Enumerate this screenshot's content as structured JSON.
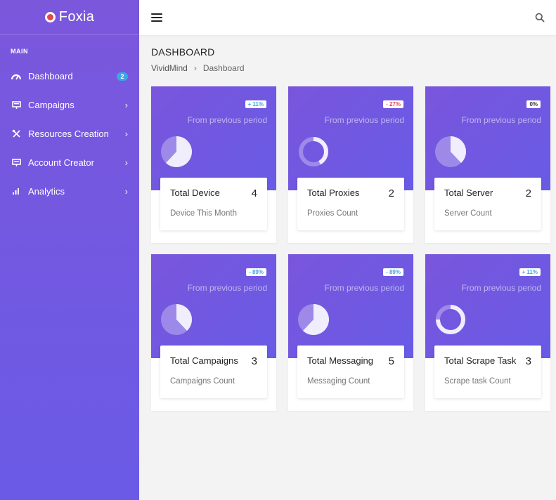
{
  "brand": {
    "name": "Foxia"
  },
  "sidebar": {
    "section_title": "MAIN",
    "items": [
      {
        "label": "Dashboard",
        "icon": "gauge-icon",
        "badge": "2"
      },
      {
        "label": "Campaigns",
        "icon": "monitor-icon"
      },
      {
        "label": "Resources Creation",
        "icon": "tools-icon"
      },
      {
        "label": "Account Creator",
        "icon": "monitor-icon"
      },
      {
        "label": "Analytics",
        "icon": "bar-chart-icon"
      }
    ]
  },
  "header": {
    "page_title": "DASHBOARD"
  },
  "breadcrumb": {
    "root": "VividMind",
    "current": "Dashboard"
  },
  "cards": [
    {
      "change": "+ 11%",
      "trend": "up",
      "from": "From previous period",
      "title": "Total Device",
      "value": "4",
      "subtitle": "Device This Month",
      "chart": "pie",
      "fill": 0.62
    },
    {
      "change": "- 27%",
      "trend": "down",
      "from": "From previous period",
      "title": "Total Proxies",
      "value": "2",
      "subtitle": "Proxies Count",
      "chart": "donut",
      "fill": 0.42
    },
    {
      "change": "0%",
      "trend": "zero",
      "from": "From previous period",
      "title": "Total Server",
      "value": "2",
      "subtitle": "Server Count",
      "chart": "pie",
      "fill": 0.38
    },
    {
      "change": "- 89%",
      "trend": "up",
      "from": "From previous period",
      "title": "Total Campaigns",
      "value": "3",
      "subtitle": "Campaigns Count",
      "chart": "pie",
      "fill": 0.38
    },
    {
      "change": "- 89%",
      "trend": "up",
      "from": "From previous period",
      "title": "Total Messaging",
      "value": "5",
      "subtitle": "Messaging Count",
      "chart": "pie",
      "fill": 0.62
    },
    {
      "change": "+ 11%",
      "trend": "up",
      "from": "From previous period",
      "title": "Total Scrape Task",
      "value": "3",
      "subtitle": "Scrape task Count",
      "chart": "donut",
      "fill": 0.75
    }
  ],
  "colors": {
    "accent": "#7457de",
    "badge": "#39a7e8",
    "up": "#3aa6e6",
    "down": "#e24a4a"
  }
}
